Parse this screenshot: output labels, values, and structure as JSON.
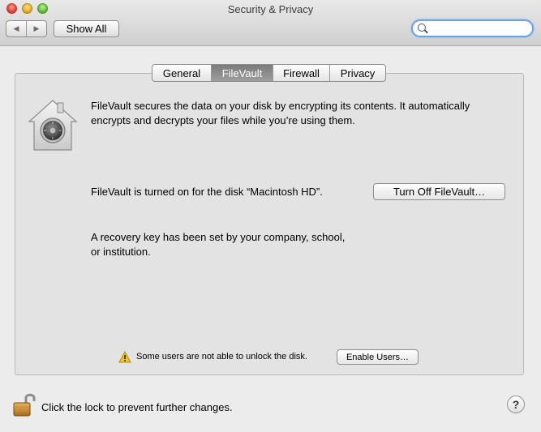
{
  "window": {
    "title": "Security & Privacy"
  },
  "toolbar": {
    "back_glyph": "◀",
    "forward_glyph": "▶",
    "show_all_label": "Show All",
    "search_placeholder": ""
  },
  "tabs": [
    {
      "label": "General",
      "active": false
    },
    {
      "label": "FileVault",
      "active": true
    },
    {
      "label": "Firewall",
      "active": false
    },
    {
      "label": "Privacy",
      "active": false
    }
  ],
  "filevault": {
    "description": "FileVault secures the data on your disk by encrypting its contents. It automatically encrypts and decrypts your files while you’re using them.",
    "status": "FileVault is turned on for the disk “Macintosh HD”.",
    "turn_off_label": "Turn Off FileVault…",
    "recovery_key_text": "A recovery key has been set by your company, school, or institution.",
    "warning_text": "Some users are not able to unlock the disk.",
    "enable_users_label": "Enable Users…"
  },
  "footer": {
    "lock_text": "Click the lock to prevent further changes.",
    "help_glyph": "?"
  },
  "icons": {
    "close": "close-button-icon",
    "minimize": "minimize-button-icon",
    "zoom": "zoom-button-icon",
    "search": "search-icon",
    "filevault": "filevault-house-icon",
    "warning": "warning-icon",
    "lock": "unlocked-padlock-icon"
  },
  "colors": {
    "accent_search_border": "#6aa2e8",
    "active_tab": "#8a8a8a",
    "warning_yellow": "#f4c51f"
  }
}
